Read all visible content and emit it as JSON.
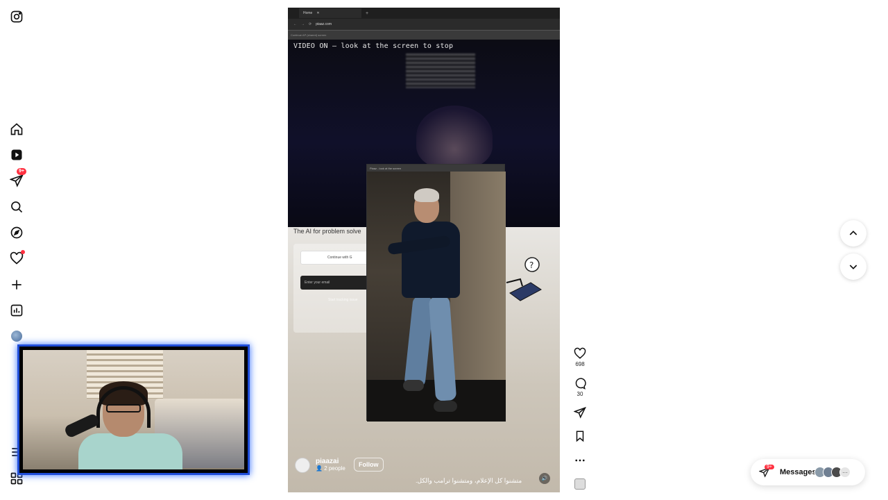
{
  "sidebar": {
    "notifications_badge": "9+"
  },
  "reel": {
    "browser": {
      "tab_title": "Home",
      "url": "piaaz.com",
      "bookmark_text": "Continue AP (shared) screen"
    },
    "video_caption": "VIDEO ON — look at the screen to stop",
    "page_headline": "The AI for problem solve",
    "google_button": "Continue with G",
    "email_placeholder": "Enter your email",
    "start_text": "Start tracking issue",
    "popup_title": "Piaaz - look at the screen",
    "author": {
      "name": "piaazai",
      "sub": "2 people"
    },
    "follow_label": "Follow",
    "caption": "متشنوا كل الإعلام، ومتشنوا ترامب والكل."
  },
  "actions": {
    "likes": "698",
    "comments": "30"
  },
  "messages": {
    "label": "Messages",
    "badge": "9+"
  },
  "colors": {
    "accent_red": "#ff3040",
    "webcam_border": "#1f4dd8"
  }
}
